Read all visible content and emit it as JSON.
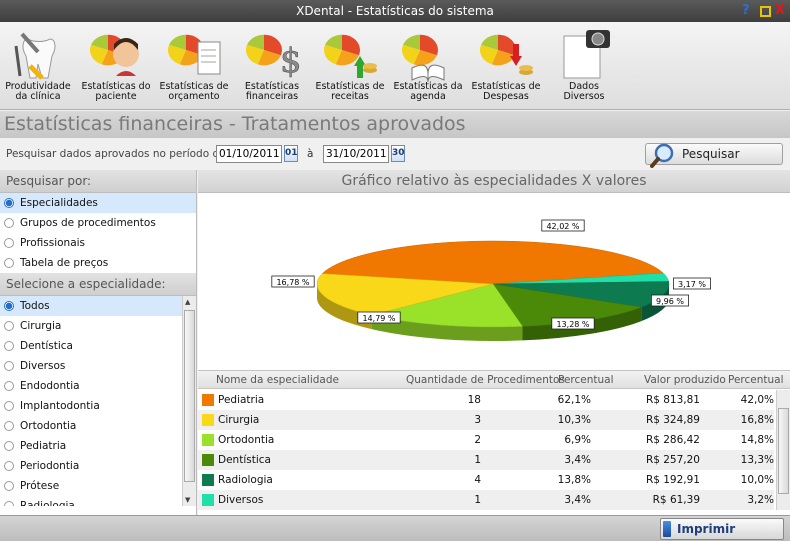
{
  "window": {
    "title": "XDental - Estatísticas do sistema",
    "help_glyph": "?",
    "close_glyph": "X"
  },
  "toolbar": {
    "items": [
      {
        "label": "Produtividade\nda clínica",
        "icon": "tooth-tools-icon"
      },
      {
        "label": "Estatísticas do\npaciente",
        "icon": "pie-patient-icon"
      },
      {
        "label": "Estatísticas de\norçamento",
        "icon": "pie-document-icon"
      },
      {
        "label": "Estatísticas\nfinanceiras",
        "icon": "pie-dollar-icon"
      },
      {
        "label": "Estatísticas de\nreceitas",
        "icon": "pie-income-icon"
      },
      {
        "label": "Estatísticas da\nagenda",
        "icon": "pie-agenda-icon"
      },
      {
        "label": "Estatísticas de\nDespesas",
        "icon": "pie-expense-icon"
      },
      {
        "label": "Dados\nDiversos",
        "icon": "camera-document-icon"
      }
    ]
  },
  "heading": "Estatísticas financeiras - Tratamentos aprovados",
  "search": {
    "label": "Pesquisar dados aprovados no período de:",
    "date_from": "01/10/2011",
    "date_to": "31/10/2011",
    "cal_from": "01",
    "cal_to": "30",
    "between": "à",
    "button": "Pesquisar"
  },
  "filter": {
    "header": "Pesquisar por:",
    "options": [
      "Especialidades",
      "Grupos de procedimentos",
      "Profissionais",
      "Tabela de preços"
    ],
    "selected": 0
  },
  "specialty": {
    "header": "Selecione a especialidade:",
    "options": [
      "Todos",
      "Cirurgia",
      "Dentística",
      "Diversos",
      "Endodontia",
      "Implantodontia",
      "Ortodontia",
      "Pediatria",
      "Periodontia",
      "Prótese",
      "Radiologia"
    ],
    "selected": 0
  },
  "chart_data": {
    "type": "pie",
    "title": "Gráfico relativo às especialidades X valores",
    "slices": [
      {
        "name": "Pediatria",
        "value": 42.02,
        "label": "42,02 %",
        "color": "#f07800"
      },
      {
        "name": "Diversos",
        "value": 3.17,
        "label": "3,17 %",
        "color": "#1fe0a8"
      },
      {
        "name": "Radiologia",
        "value": 9.96,
        "label": "9,96 %",
        "color": "#0e7a50"
      },
      {
        "name": "Dentística",
        "value": 13.28,
        "label": "13,28 %",
        "color": "#4a8a08"
      },
      {
        "name": "Ortodontia",
        "value": 14.79,
        "label": "14,79 %",
        "color": "#9ae22a"
      },
      {
        "name": "Cirurgia",
        "value": 16.78,
        "label": "16,78 %",
        "color": "#f8d818"
      }
    ]
  },
  "table": {
    "headers": [
      "Nome da especialidade",
      "Quantidade de Procedimentos",
      "Percentual",
      "Valor produzido",
      "Percentual"
    ],
    "rows": [
      {
        "name": "Pediatria",
        "qty": "18",
        "pct_qty": "62,1%",
        "value": "R$ 813,81",
        "pct_value": "42,0%",
        "color": "#f07800"
      },
      {
        "name": "Cirurgia",
        "qty": "3",
        "pct_qty": "10,3%",
        "value": "R$ 324,89",
        "pct_value": "16,8%",
        "color": "#f8d818"
      },
      {
        "name": "Ortodontia",
        "qty": "2",
        "pct_qty": "6,9%",
        "value": "R$ 286,42",
        "pct_value": "14,8%",
        "color": "#9ae22a"
      },
      {
        "name": "Dentística",
        "qty": "1",
        "pct_qty": "3,4%",
        "value": "R$ 257,20",
        "pct_value": "13,3%",
        "color": "#4a8a08"
      },
      {
        "name": "Radiologia",
        "qty": "4",
        "pct_qty": "13,8%",
        "value": "R$ 192,91",
        "pct_value": "10,0%",
        "color": "#0e7a50"
      },
      {
        "name": "Diversos",
        "qty": "1",
        "pct_qty": "3,4%",
        "value": "R$ 61,39",
        "pct_value": "3,2%",
        "color": "#1fe0a8"
      }
    ]
  },
  "footer": {
    "print_button": "Imprimir"
  }
}
